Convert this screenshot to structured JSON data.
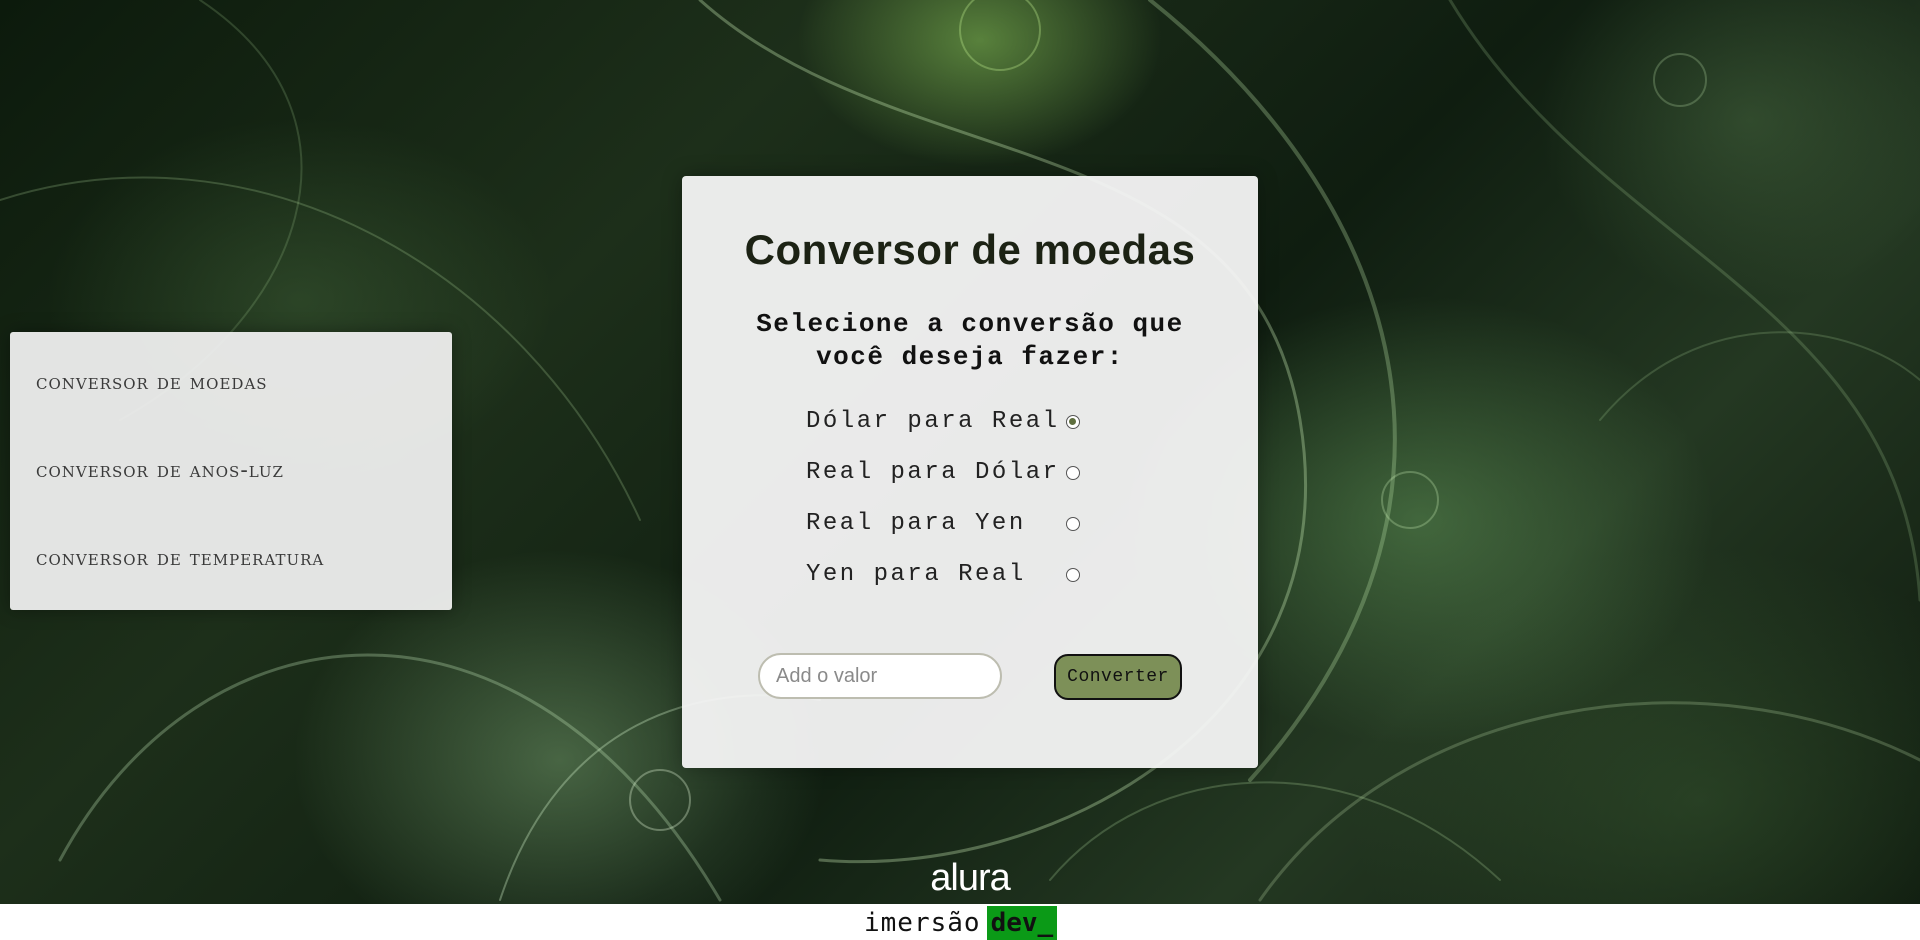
{
  "sidebar": {
    "items": [
      {
        "label": "Conversor de moedas"
      },
      {
        "label": "Conversor de anos-luz"
      },
      {
        "label": "Conversor de temperatura"
      }
    ]
  },
  "card": {
    "title": "Conversor de moedas",
    "subtitle": "Selecione a conversão que você deseja fazer:",
    "options": [
      {
        "label": "Dólar para Real",
        "selected": true
      },
      {
        "label": "Real para Dólar",
        "selected": false
      },
      {
        "label": "Real para Yen",
        "selected": false
      },
      {
        "label": "Yen para Real",
        "selected": false
      }
    ],
    "input_placeholder": "Add o valor",
    "button_label": "Converter"
  },
  "logo": {
    "text": "alura"
  },
  "footer": {
    "brand_text": "imersão",
    "brand_highlight": "dev_",
    "highlight_color": "#0b9a17"
  }
}
